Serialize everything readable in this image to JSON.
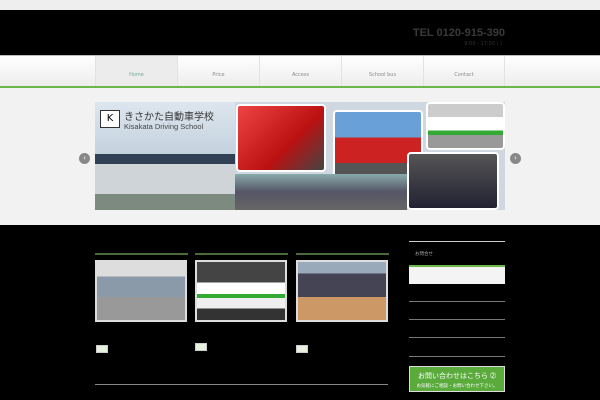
{
  "header": {
    "tel": "TEL 0120-915-390",
    "hours": "9:00 - 17:00 ( )"
  },
  "nav": [
    {
      "label": "Home"
    },
    {
      "label": "Price"
    },
    {
      "label": "Access"
    },
    {
      "label": "School bus"
    },
    {
      "label": "Contact"
    }
  ],
  "slider": {
    "logo_mark": "K",
    "title_ja": "きさかた自動車学校",
    "title_en": "Kisakata Driving School",
    "prev": "‹",
    "next": "›"
  },
  "sidebar": {
    "label": "お問合せ",
    "contact_title": "お問い合わせはこちら ➁",
    "contact_sub": "お気軽にご相談・お問い合わせ下さい。"
  },
  "colors": {
    "accent": "#6bb74a"
  }
}
